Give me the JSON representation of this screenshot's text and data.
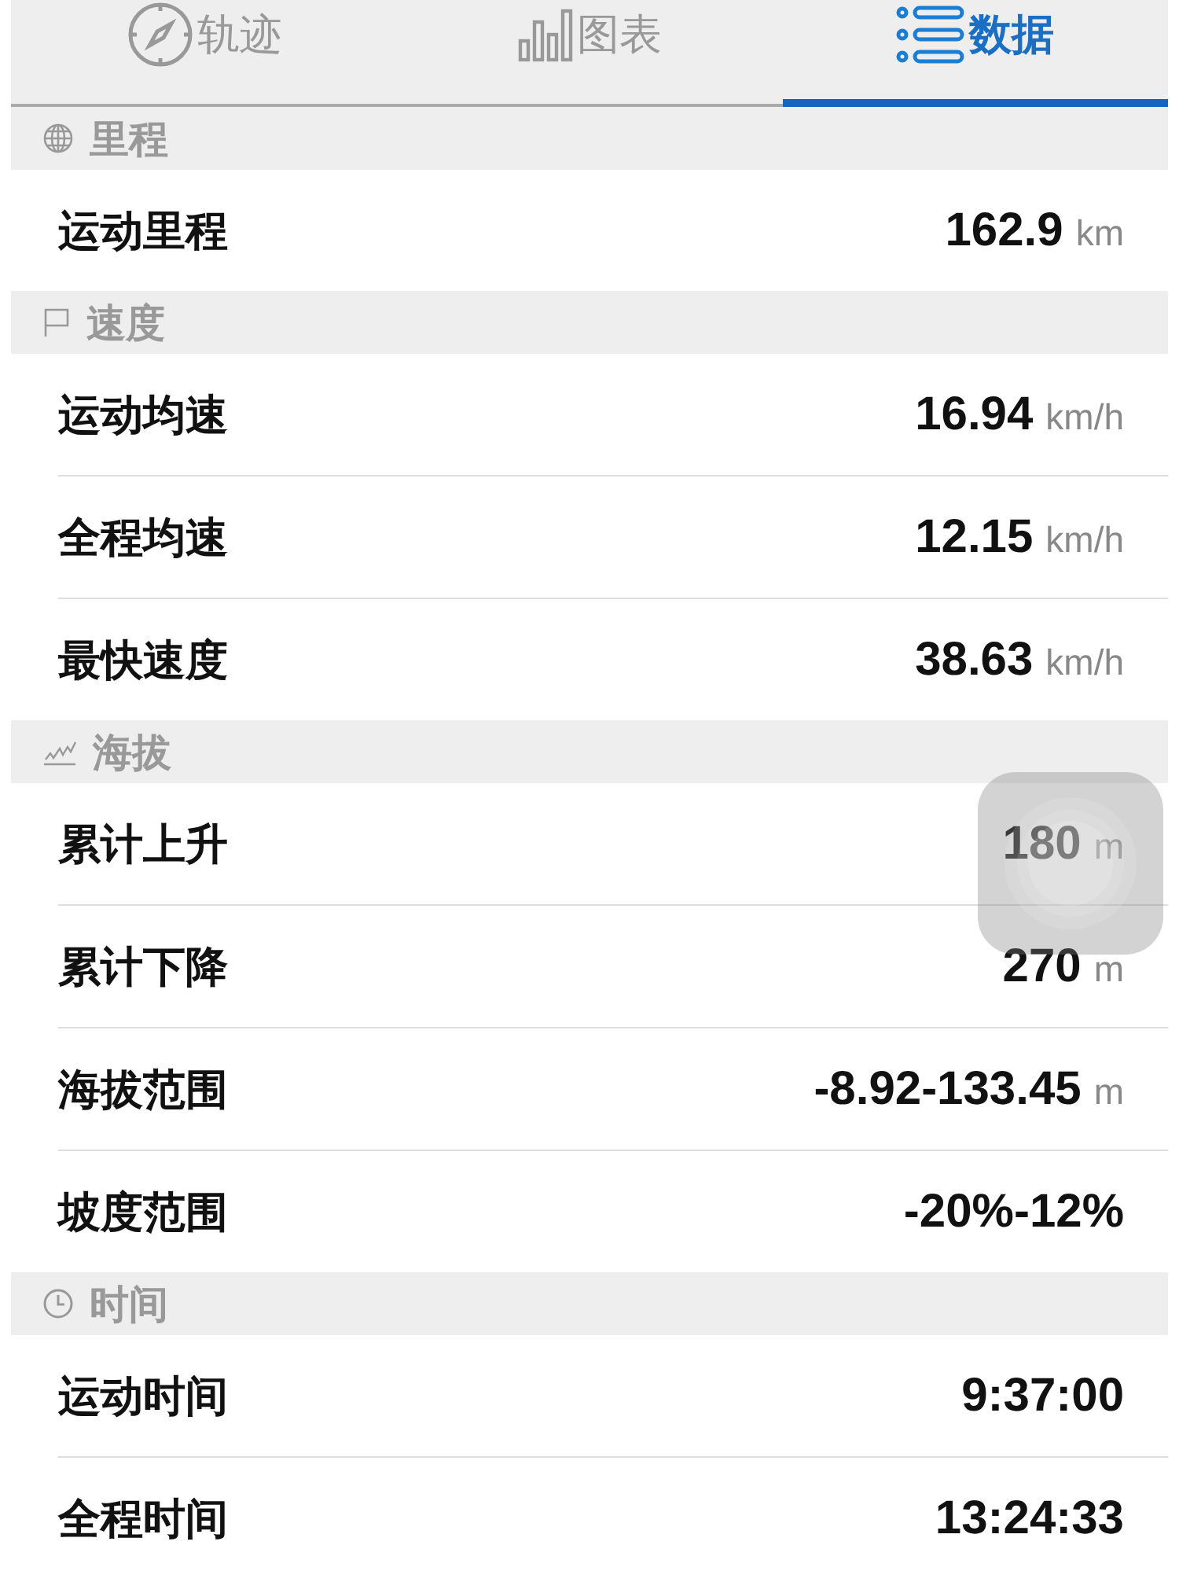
{
  "tabs": [
    {
      "label": "轨迹",
      "selected": false
    },
    {
      "label": "图表",
      "selected": false
    },
    {
      "label": "数据",
      "selected": true
    }
  ],
  "sections": [
    {
      "title": "里程",
      "rows": [
        {
          "label": "运动里程",
          "value": "162.9",
          "unit": "km"
        }
      ]
    },
    {
      "title": "速度",
      "rows": [
        {
          "label": "运动均速",
          "value": "16.94",
          "unit": "km/h"
        },
        {
          "label": "全程均速",
          "value": "12.15",
          "unit": "km/h"
        },
        {
          "label": "最快速度",
          "value": "38.63",
          "unit": "km/h"
        }
      ]
    },
    {
      "title": "海拔",
      "rows": [
        {
          "label": "累计上升",
          "value": "180",
          "unit": "m"
        },
        {
          "label": "累计下降",
          "value": "270",
          "unit": "m"
        },
        {
          "label": "海拔范围",
          "value": "-8.92-133.45",
          "unit": "m"
        },
        {
          "label": "坡度范围",
          "value": "-20%-12%"
        }
      ]
    },
    {
      "title": "时间",
      "rows": [
        {
          "label": "运动时间",
          "value": "9:37:00"
        },
        {
          "label": "全程时间",
          "value": "13:24:33"
        }
      ]
    }
  ]
}
